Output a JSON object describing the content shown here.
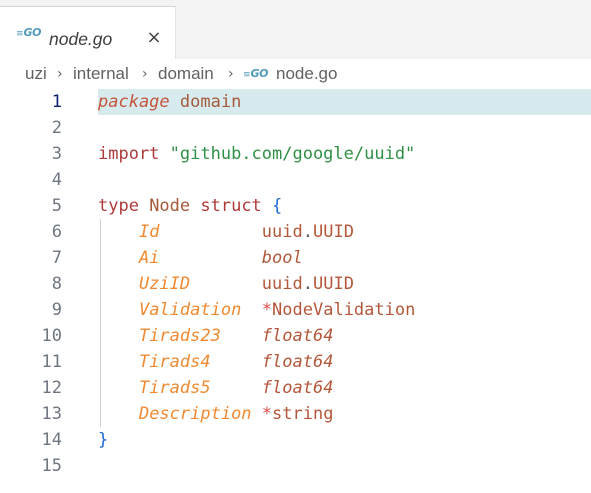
{
  "tab": {
    "icon": "go-file-icon",
    "icon_text": "GO",
    "label": "node.go",
    "close_glyph": "×"
  },
  "breadcrumb": {
    "items": [
      "uzi",
      "internal",
      "domain",
      "node.go"
    ],
    "separator": "›",
    "file_icon_text": "GO"
  },
  "editor": {
    "current_line": 1,
    "lines": [
      {
        "n": "1",
        "tokens": [
          [
            "kw-i",
            "package"
          ],
          [
            "ident",
            " domain"
          ]
        ]
      },
      {
        "n": "2",
        "tokens": []
      },
      {
        "n": "3",
        "tokens": [
          [
            "kw",
            "import"
          ],
          [
            "str",
            " \"github.com/google/uuid\""
          ]
        ]
      },
      {
        "n": "4",
        "tokens": []
      },
      {
        "n": "5",
        "tokens": [
          [
            "kw",
            "type"
          ],
          [
            "ident",
            " Node "
          ],
          [
            "kw",
            "struct"
          ],
          [
            "brace",
            " {"
          ]
        ]
      },
      {
        "n": "6",
        "tokens": [
          [
            "ident",
            "    "
          ],
          [
            "field",
            "Id"
          ],
          [
            "ident",
            "          "
          ],
          [
            "ty",
            "uuid"
          ],
          [
            "dot",
            "."
          ],
          [
            "ty",
            "UUID"
          ]
        ]
      },
      {
        "n": "7",
        "tokens": [
          [
            "ident",
            "    "
          ],
          [
            "field",
            "Ai"
          ],
          [
            "ident",
            "          "
          ],
          [
            "ty-i",
            "bool"
          ]
        ]
      },
      {
        "n": "8",
        "tokens": [
          [
            "ident",
            "    "
          ],
          [
            "field",
            "UziID"
          ],
          [
            "ident",
            "       "
          ],
          [
            "ty",
            "uuid"
          ],
          [
            "dot",
            "."
          ],
          [
            "ty",
            "UUID"
          ]
        ]
      },
      {
        "n": "9",
        "tokens": [
          [
            "ident",
            "    "
          ],
          [
            "field",
            "Validation"
          ],
          [
            "ident",
            "  "
          ],
          [
            "star",
            "*"
          ],
          [
            "ty",
            "NodeValidation"
          ]
        ]
      },
      {
        "n": "10",
        "tokens": [
          [
            "ident",
            "    "
          ],
          [
            "field",
            "Tirads23"
          ],
          [
            "ident",
            "    "
          ],
          [
            "ty-i",
            "float64"
          ]
        ]
      },
      {
        "n": "11",
        "tokens": [
          [
            "ident",
            "    "
          ],
          [
            "field",
            "Tirads4"
          ],
          [
            "ident",
            "     "
          ],
          [
            "ty-i",
            "float64"
          ]
        ]
      },
      {
        "n": "12",
        "tokens": [
          [
            "ident",
            "    "
          ],
          [
            "field",
            "Tirads5"
          ],
          [
            "ident",
            "     "
          ],
          [
            "ty-i",
            "float64"
          ]
        ]
      },
      {
        "n": "13",
        "tokens": [
          [
            "ident",
            "    "
          ],
          [
            "field",
            "Description"
          ],
          [
            "ident",
            " "
          ],
          [
            "star",
            "*"
          ],
          [
            "ty",
            "string"
          ]
        ]
      },
      {
        "n": "14",
        "tokens": [
          [
            "brace",
            "}"
          ]
        ]
      },
      {
        "n": "15",
        "tokens": []
      }
    ]
  },
  "colors": {
    "current_line_bg": "#d7ebef",
    "keyword": "#af3a3a",
    "string": "#2f9145",
    "field": "#f08a32",
    "brace": "#1a68d6",
    "go_icon": "#519aba"
  }
}
